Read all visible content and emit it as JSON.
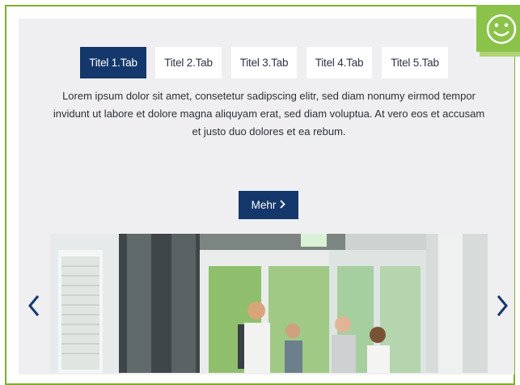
{
  "tabs": [
    {
      "label": "Titel 1.Tab",
      "active": true
    },
    {
      "label": "Titel 2.Tab",
      "active": false
    },
    {
      "label": "Titel 3.Tab",
      "active": false
    },
    {
      "label": "Titel 4.Tab",
      "active": false
    },
    {
      "label": "Titel 5.Tab",
      "active": false
    }
  ],
  "content": {
    "text": "Lorem ipsum dolor sit amet, consetetur sadipscing elitr, sed diam nonumy eirmod tempor invidunt ut labore et dolore magna aliquyam erat, sed diam voluptua. At vero eos et accusam et justo duo dolores et ea rebum.",
    "more_label": "Mehr"
  },
  "icons": {
    "more_chevron": "chevron-right-icon",
    "prev": "chevron-left-icon",
    "next": "chevron-right-icon",
    "feedback": "smiley-icon"
  },
  "colors": {
    "primary": "#14386b",
    "accent_green": "#7fae2a",
    "panel_background": "#efeff1"
  }
}
